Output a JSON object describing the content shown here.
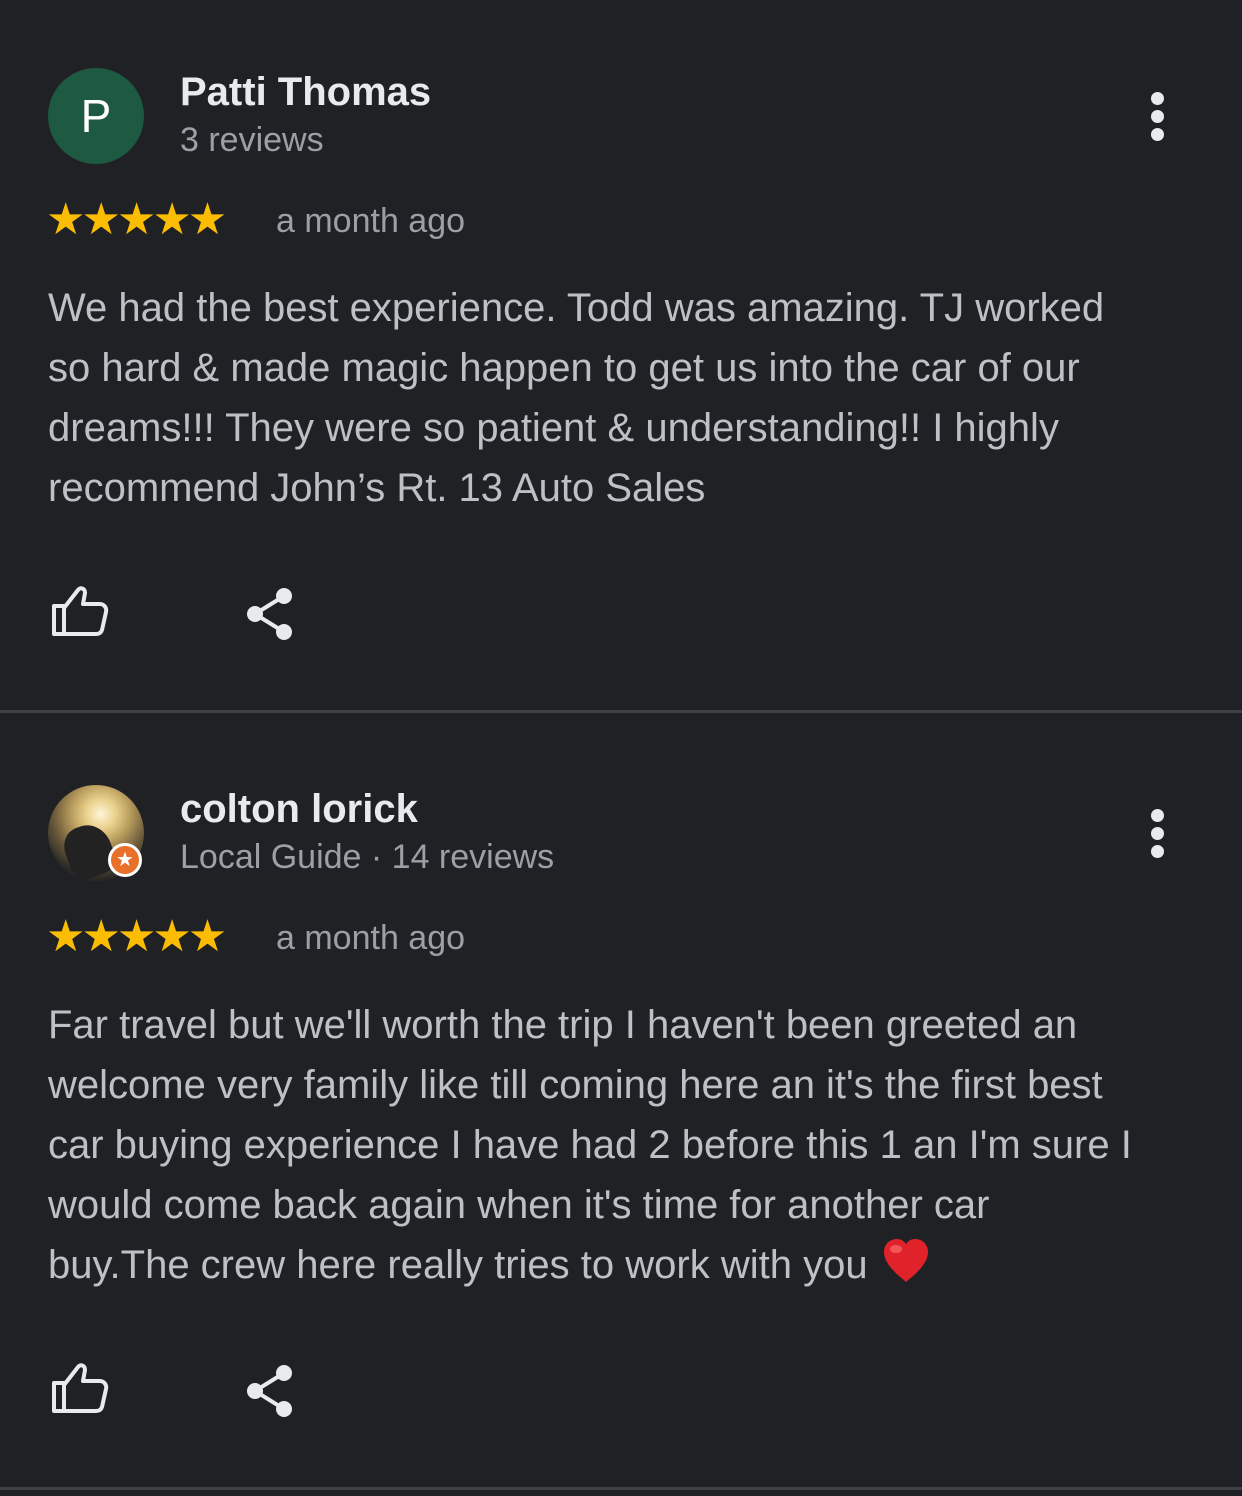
{
  "reviews": [
    {
      "name": "Patti Thomas",
      "avatar_letter": "P",
      "avatar_color": "#1e5941",
      "subtitle": "3 reviews",
      "rating": 5,
      "stars": "★★★★★",
      "time": "a month ago",
      "body_lines": [
        "We had the best experience. Todd was amazing. TJ worked",
        "so hard & made magic happen to get us into the car of our",
        "dreams!!! They were so patient & understanding!! I highly",
        "recommend John’s Rt. 13 Auto Sales"
      ],
      "icons": [
        "thumbs-up-icon",
        "share-icon",
        "more-vert-icon"
      ]
    },
    {
      "name": "colton lorick",
      "subtitle": "Local Guide · 14 reviews",
      "badge_icon": "local-guide-star-icon",
      "badge_color": "#e8702a",
      "rating": 5,
      "stars": "★★★★★",
      "time": "a month ago",
      "body_lines": [
        "Far travel but we'll worth the trip I haven't been greeted an",
        "welcome very family like till coming here an it's the first best",
        "car buying experience I have had 2 before this 1 an I'm sure I",
        "would come back again when it's time for another car",
        "buy.The crew here really tries to work with you"
      ],
      "emoji": "red-heart-icon",
      "icons": [
        "thumbs-up-icon",
        "share-icon",
        "more-vert-icon"
      ]
    }
  ],
  "colors": {
    "background": "#202124",
    "star": "#fbbc04",
    "divider": "#3c4043"
  }
}
